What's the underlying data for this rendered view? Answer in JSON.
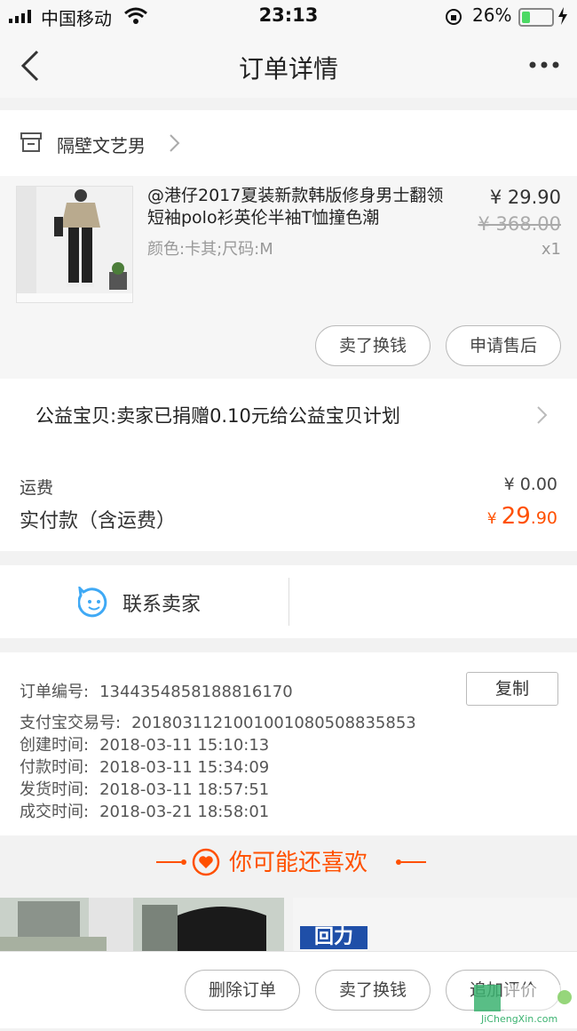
{
  "status_bar": {
    "carrier": "中国移动",
    "time": "23:13",
    "battery": "26%"
  },
  "nav": {
    "title": "订单详情"
  },
  "store": {
    "name": "隔壁文艺男"
  },
  "product": {
    "title": "@港仔2017夏装新款韩版修身男士翻领短袖polo衫英伦半袖T恤撞色潮",
    "spec": "颜色:卡其;尺码:M",
    "price": "¥ 29.90",
    "original_price": "¥ 368.00",
    "quantity": "x1",
    "actions": [
      "卖了换钱",
      "申请售后"
    ]
  },
  "charity": {
    "text": "公益宝贝:卖家已捐赠0.10元给公益宝贝计划"
  },
  "fees": {
    "shipping_label": "运费",
    "shipping_value": "¥ 0.00",
    "paid_label": "实付款（含运费）",
    "paid_currency": "¥",
    "paid_integer": "29",
    "paid_decimal": ".90"
  },
  "contact": {
    "label": "联系卖家"
  },
  "order_info": {
    "copy_label": "复制",
    "rows": [
      {
        "label": "订单编号:",
        "value": "1344354858188816170"
      },
      {
        "label": "支付宝交易号:",
        "value": "2018031121001001080508835853"
      },
      {
        "label": "创建时间:",
        "value": "2018-03-11 15:10:13"
      },
      {
        "label": "付款时间:",
        "value": "2018-03-11 15:34:09"
      },
      {
        "label": "发货时间:",
        "value": "2018-03-11 18:57:51"
      },
      {
        "label": "成交时间:",
        "value": "2018-03-21 18:58:01"
      }
    ]
  },
  "recommend": {
    "title": "你可能还喜欢",
    "brand_text": "回力"
  },
  "bottom_actions": [
    "删除订单",
    "卖了换钱",
    "追加评价"
  ],
  "watermark": {
    "text": "JiChengXin.com"
  },
  "colors": {
    "accent": "#ff5000",
    "contact_icon": "#3fa9f5",
    "battery": "#4cd964"
  }
}
